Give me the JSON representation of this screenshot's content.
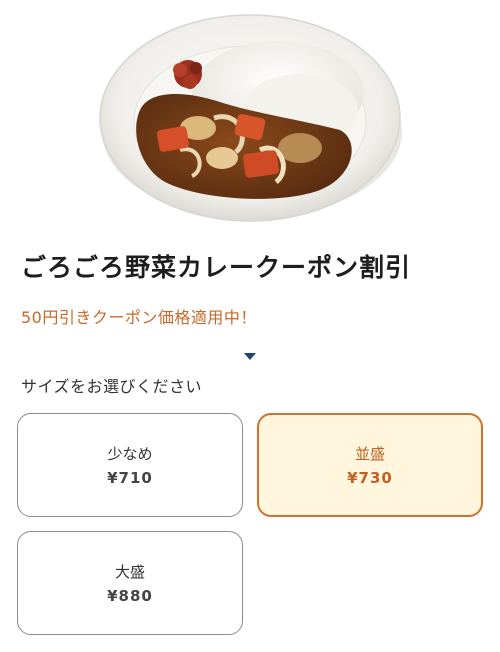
{
  "product": {
    "title": "ごろごろ野菜カレークーポン割引",
    "promo_text": "50円引きクーポン価格適用中！",
    "image_icon": "curry-plate-image"
  },
  "size_selector": {
    "label": "サイズをお選びください",
    "options": [
      {
        "name": "少なめ",
        "price": "¥710",
        "selected": false
      },
      {
        "name": "並盛",
        "price": "¥730",
        "selected": true
      },
      {
        "name": "大盛",
        "price": "¥880",
        "selected": false
      }
    ]
  },
  "colors": {
    "accent": "#c8692a",
    "selected_border": "#d0702e",
    "selected_bg": "#fff6dd",
    "chevron": "#1f3f78"
  }
}
